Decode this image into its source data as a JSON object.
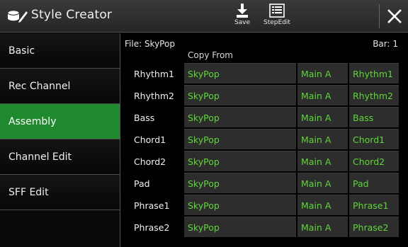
{
  "header": {
    "title": "Style Creator",
    "save_label": "Save",
    "stepedit_label": "StepEdit"
  },
  "sidebar": {
    "items": [
      {
        "label": "Basic",
        "active": false
      },
      {
        "label": "Rec Channel",
        "active": false
      },
      {
        "label": "Assembly",
        "active": true
      },
      {
        "label": "Channel Edit",
        "active": false
      },
      {
        "label": "SFF Edit",
        "active": false
      }
    ]
  },
  "main": {
    "file": "File: SkyPop",
    "bar": "Bar:  1",
    "copy_from_header": "Copy From",
    "rows": [
      {
        "part": "Rhythm1",
        "style": "SkyPop",
        "section": "Main A",
        "channel": "Rhythm1"
      },
      {
        "part": "Rhythm2",
        "style": "SkyPop",
        "section": "Main A",
        "channel": "Rhythm2"
      },
      {
        "part": "Bass",
        "style": "SkyPop",
        "section": "Main A",
        "channel": "Bass"
      },
      {
        "part": "Chord1",
        "style": "SkyPop",
        "section": "Main A",
        "channel": "Chord1"
      },
      {
        "part": "Chord2",
        "style": "SkyPop",
        "section": "Main A",
        "channel": "Chord2"
      },
      {
        "part": "Pad",
        "style": "SkyPop",
        "section": "Main A",
        "channel": "Pad"
      },
      {
        "part": "Phrase1",
        "style": "SkyPop",
        "section": "Main A",
        "channel": "Phrase1"
      },
      {
        "part": "Phrase2",
        "style": "SkyPop",
        "section": "Main A",
        "channel": "Phrase2"
      }
    ]
  },
  "colors": {
    "accent_green": "#1f8a2e",
    "value_text": "#5fd63a",
    "cell_bg": "#2d2d2d"
  },
  "icons": {
    "title": "style-creator-icon",
    "save": "save-icon",
    "stepedit": "list-icon",
    "close": "close-icon"
  }
}
